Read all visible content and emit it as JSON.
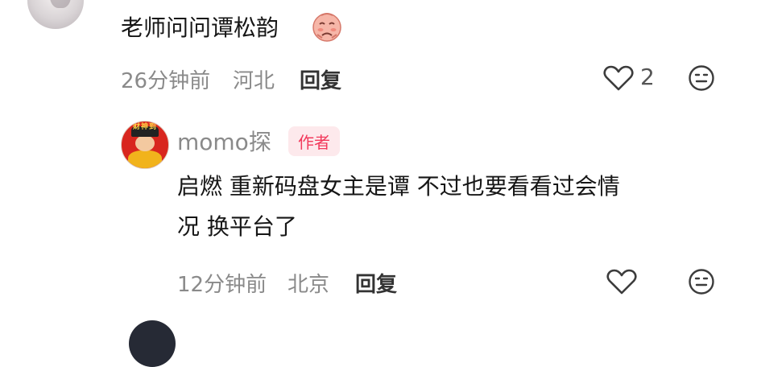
{
  "top_comment": {
    "text": "老师问问谭松韵",
    "emoji": "pleading-face-emoji",
    "time": "26分钟前",
    "location": "河北",
    "reply_label": "回复",
    "like_count": "2"
  },
  "reply_comment": {
    "author": "momo探",
    "author_badge": "作者",
    "avatar_banner": "财神到",
    "text_line1": "启燃 重新码盘女主是谭 不过也要看看过会情",
    "text_line2": "况 换平台了",
    "time": "12分钟前",
    "location": "北京",
    "reply_label": "回复"
  },
  "colors": {
    "badge_bg": "#fde9ec",
    "badge_text": "#f2395b",
    "meta_text": "#8a8a8a",
    "body_text": "#161616"
  },
  "icons": [
    "heart-icon",
    "face-icon",
    "pleading-face-emoji"
  ]
}
